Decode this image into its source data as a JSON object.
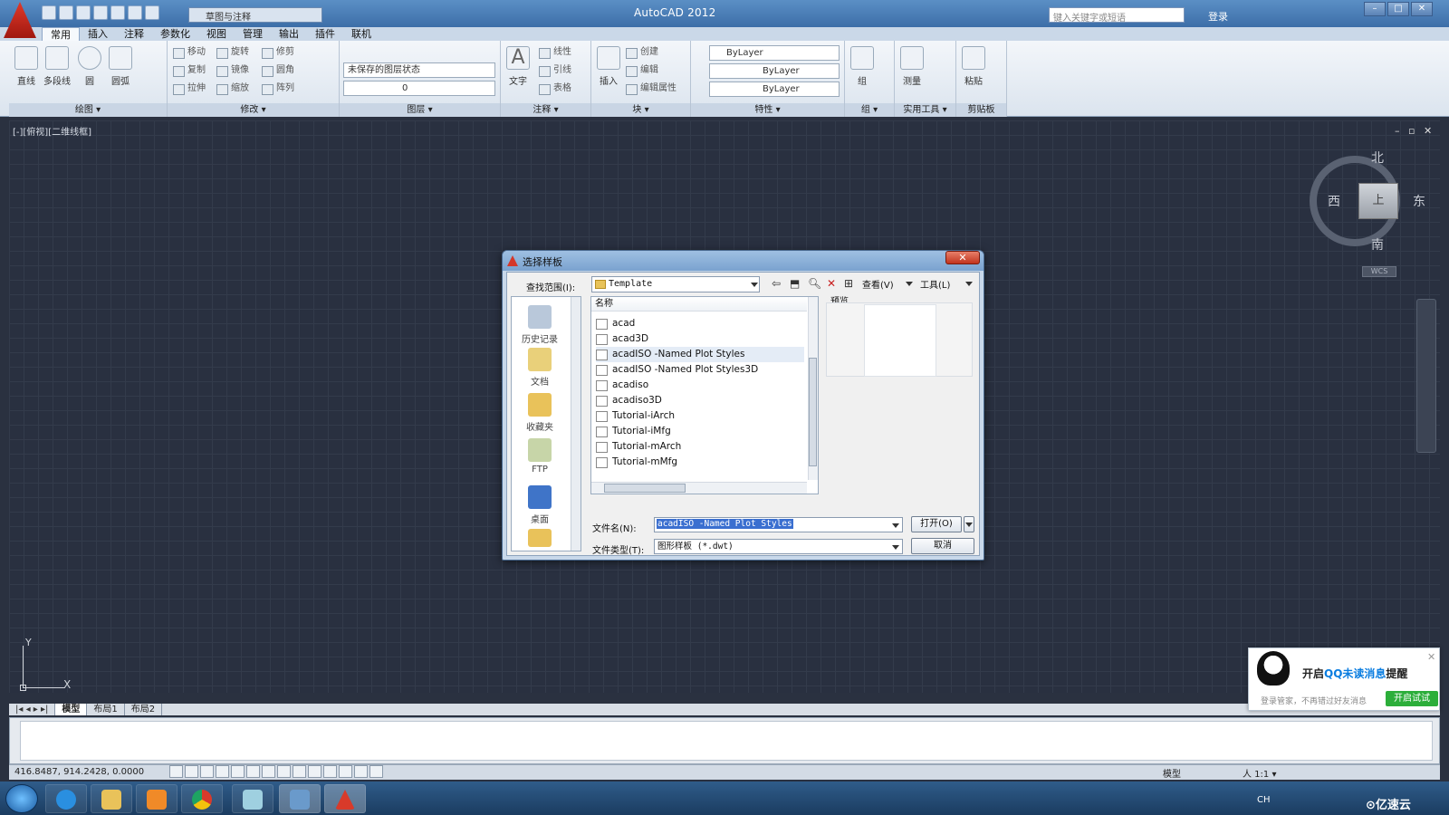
{
  "app": {
    "title": "AutoCAD 2012",
    "workspace": "草图与注释",
    "search_placeholder": "键入关键字或短语",
    "login": "登录"
  },
  "ribbon": {
    "tabs": [
      "常用",
      "插入",
      "注释",
      "参数化",
      "视图",
      "管理",
      "输出",
      "插件",
      "联机"
    ],
    "active_tab": "常用",
    "draw": {
      "title": "绘图 ▾",
      "line": "直线",
      "polyline": "多段线",
      "circle": "圆",
      "arc": "圆弧"
    },
    "modify": {
      "title": "修改 ▾",
      "move": "移动",
      "rotate": "旋转",
      "trim": "修剪",
      "copy": "复制",
      "mirror": "镜像",
      "fillet": "圆角",
      "stretch": "拉伸",
      "scale": "缩放",
      "array": "阵列"
    },
    "layers": {
      "title": "图层 ▾",
      "state": "未保存的图层状态",
      "current": "0"
    },
    "annotation": {
      "title": "注释 ▾",
      "text": "文字",
      "linear": "线性",
      "leader": "引线",
      "table": "表格"
    },
    "block": {
      "title": "块 ▾",
      "insert": "插入",
      "create": "创建",
      "edit": "编辑",
      "edit_attr": "编辑属性"
    },
    "properties": {
      "title": "特性 ▾",
      "color": "ByLayer",
      "linetype": "ByLayer",
      "lineweight": "ByLayer"
    },
    "groups": {
      "title": "组 ▾",
      "group": "组"
    },
    "utilities": {
      "title": "实用工具 ▾",
      "measure": "测量"
    },
    "clipboard": {
      "title": "剪贴板",
      "paste": "粘贴"
    }
  },
  "viewport": {
    "label": "[-][俯视][二维线框]",
    "compass": {
      "north": "北",
      "south": "南",
      "east": "东",
      "west": "西",
      "wcs": "WCS",
      "top_face": "上"
    },
    "ucs": {
      "x": "X",
      "y": "Y"
    }
  },
  "layout_tabs": [
    "模型",
    "布局1",
    "布局2"
  ],
  "status": {
    "coords": "416.8487,  914.2428, 0.0000",
    "model": "模型",
    "scale": "人 1:1 ▾"
  },
  "qq_popup": {
    "title_pre": "开启",
    "title_hl": "QQ未读消息",
    "title_post": "提醒",
    "subtitle": "登录管家，不再错过好友消息",
    "button": "开启试试"
  },
  "taskbar": {
    "lang": "CH",
    "brand": "⊙亿速云"
  },
  "dialog": {
    "title": "选择样板",
    "look_in_label": "查找范围(I):",
    "look_in_value": "Template",
    "view_label": "查看(V)",
    "tools_label": "工具(L)",
    "places": [
      "历史记录",
      "文档",
      "收藏夹",
      "FTP",
      "桌面"
    ],
    "column_name": "名称",
    "files": [
      "acad",
      "acad3D",
      "acadISO -Named Plot Styles",
      "acadISO -Named Plot Styles3D",
      "acadiso",
      "acadiso3D",
      "Tutorial-iArch",
      "Tutorial-iMfg",
      "Tutorial-mArch",
      "Tutorial-mMfg"
    ],
    "selected_file": "acadISO -Named Plot Styles",
    "preview_label": "预览",
    "filename_label": "文件名(N):",
    "filename_value": "acadISO -Named Plot Styles",
    "filetype_label": "文件类型(T):",
    "filetype_value": "图形样板 (*.dwt)",
    "open_button": "打开(O)",
    "cancel_button": "取消"
  }
}
